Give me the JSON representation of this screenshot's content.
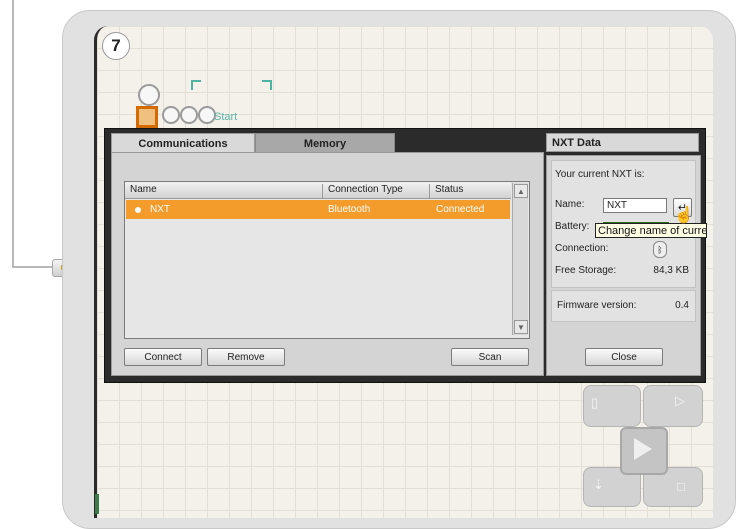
{
  "sequence_number": "7",
  "start_block": {
    "label": "Start"
  },
  "dialog": {
    "tabs": [
      {
        "label": "Communications",
        "active": true
      },
      {
        "label": "Memory",
        "active": false
      }
    ],
    "list": {
      "columns": [
        "Name",
        "Connection Type",
        "Status"
      ],
      "rows": [
        {
          "name": "NXT",
          "connection_type": "Bluetooth",
          "status": "Connected",
          "selected": true
        }
      ]
    },
    "buttons": {
      "connect": "Connect",
      "remove": "Remove",
      "scan": "Scan"
    }
  },
  "nxt_data": {
    "title": "NXT Data",
    "current_label": "Your current NXT is:",
    "name_label": "Name:",
    "name_value": "NXT",
    "battery_label": "Battery:",
    "connection_label": "Connection:",
    "free_storage_label": "Free Storage:",
    "free_storage_value": "84,3 KB",
    "firmware_label": "Firmware version:",
    "firmware_value": "0.4",
    "close_label": "Close",
    "tooltip": "Change name of current NXT"
  },
  "colors": {
    "selection": "#f39b2b",
    "battery": "#6abf3a",
    "dialog_bg": "#2b2b2b"
  },
  "icons": [
    "enter-icon",
    "bluetooth-icon",
    "play-icon",
    "cursor-icon"
  ]
}
